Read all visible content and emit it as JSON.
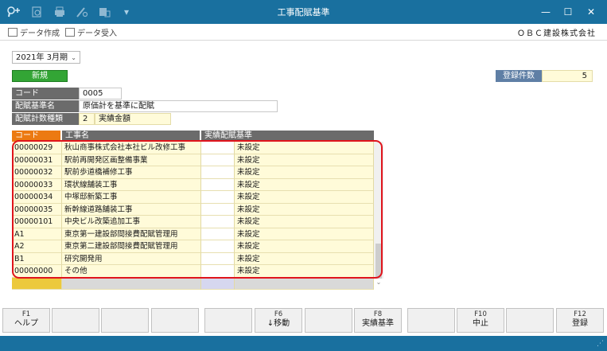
{
  "window": {
    "title": "工事配賦基準",
    "toolbar_icons": [
      "search-plus-icon",
      "zoom-icon",
      "print-icon",
      "tools-icon",
      "export-icon",
      "dropdown-arrow-icon"
    ],
    "controls": [
      "minimize",
      "maximize",
      "close"
    ]
  },
  "menu": {
    "data_create": "データ作成",
    "data_receive": "データ受入",
    "company": "ＯＢＣ建設株式会社"
  },
  "period": {
    "value": "2021年  3月期"
  },
  "new_button": "新規",
  "registration": {
    "label": "登録件数",
    "value": "5"
  },
  "fields": {
    "code": {
      "label": "コード",
      "value": "0005"
    },
    "basis_name": {
      "label": "配賦基準名",
      "value": "原価計を基準に配賦"
    },
    "calc_type": {
      "label": "配賦計数種類",
      "num": "2",
      "text": "実績金額"
    }
  },
  "grid": {
    "headers": [
      "コード",
      "工事名",
      "実績配賦基準"
    ],
    "rows": [
      {
        "code": "00000029",
        "name": "秋山商事株式会社本社ビル改修工事",
        "basis": "",
        "status": "未設定"
      },
      {
        "code": "00000031",
        "name": "駅前再開発区画整備事業",
        "basis": "",
        "status": "未設定"
      },
      {
        "code": "00000032",
        "name": "駅前歩道橋補修工事",
        "basis": "",
        "status": "未設定"
      },
      {
        "code": "00000033",
        "name": "環状線舗装工事",
        "basis": "",
        "status": "未設定"
      },
      {
        "code": "00000034",
        "name": "中塚邸新築工事",
        "basis": "",
        "status": "未設定"
      },
      {
        "code": "00000035",
        "name": "新幹線道路舗装工事",
        "basis": "",
        "status": "未設定"
      },
      {
        "code": "00000101",
        "name": "中央ビル改築追加工事",
        "basis": "",
        "status": "未設定"
      },
      {
        "code": "A1",
        "name": "東京第一建設部間接費配賦管理用",
        "basis": "",
        "status": "未設定"
      },
      {
        "code": "A2",
        "name": "東京第二建設部間接費配賦管理用",
        "basis": "",
        "status": "未設定"
      },
      {
        "code": "B1",
        "name": "研究開発用",
        "basis": "",
        "status": "未設定"
      },
      {
        "code": "00000000",
        "name": "その他",
        "basis": "",
        "status": "未設定"
      }
    ]
  },
  "function_keys": [
    {
      "key": "F1",
      "label": "ヘルプ"
    },
    {
      "key": "",
      "label": ""
    },
    {
      "key": "",
      "label": ""
    },
    {
      "key": "",
      "label": ""
    },
    {
      "key": "",
      "label": ""
    },
    {
      "key": "F6",
      "label": "↓移動"
    },
    {
      "key": "",
      "label": ""
    },
    {
      "key": "F8",
      "label": "実績基準"
    },
    {
      "key": "",
      "label": ""
    },
    {
      "key": "F10",
      "label": "中止"
    },
    {
      "key": "",
      "label": ""
    },
    {
      "key": "F12",
      "label": "登録"
    }
  ],
  "colors": {
    "titlebar": "#19709f",
    "new_button": "#33a535",
    "header_active": "#ec7a12",
    "header": "#6b6b6b",
    "cell_bg": "#fffbd9",
    "highlight": "#e0141c"
  }
}
